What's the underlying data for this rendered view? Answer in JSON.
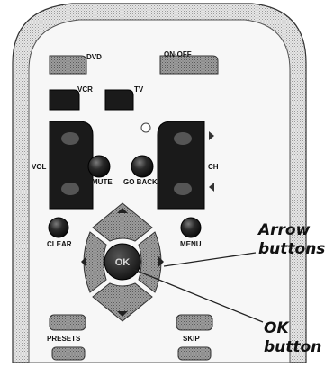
{
  "remote": {
    "buttons": {
      "dvd": "DVD",
      "on_off": "ON·OFF",
      "vcr": "VCR",
      "tv": "TV",
      "vol": "VOL",
      "ch": "CH",
      "mute": "MUTE",
      "go_back": "GO BACK",
      "clear": "CLEAR",
      "menu": "MENU",
      "ok": "OK",
      "presets": "PRESETS",
      "skip": "SKIP"
    }
  },
  "callouts": {
    "arrow_line1": "Arrow",
    "arrow_line2": "buttons",
    "ok_line1": "OK",
    "ok_line2": "button"
  },
  "colors": {
    "remote_body": "#d4d4d4",
    "button_dark": "#1a1a1a",
    "button_gray": "#8a8a8a"
  }
}
